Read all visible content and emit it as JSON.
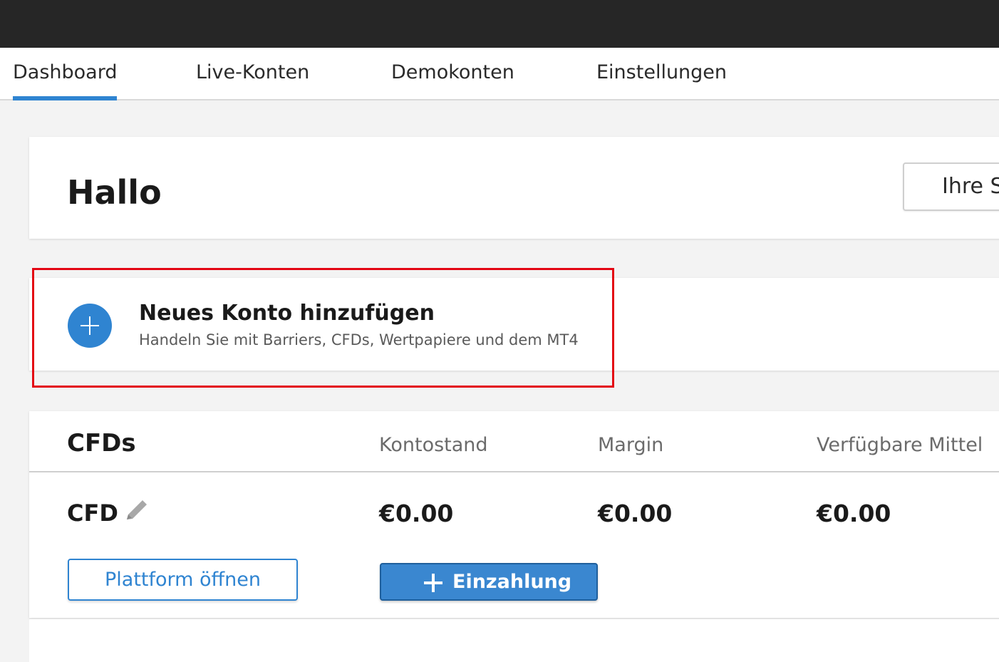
{
  "tabs": [
    {
      "label": "Dashboard",
      "active": true
    },
    {
      "label": "Live-Konten",
      "active": false
    },
    {
      "label": "Demokonten",
      "active": false
    },
    {
      "label": "Einstellungen",
      "active": false
    }
  ],
  "hello": {
    "greeting": "Hallo",
    "button_label": "Ihre S"
  },
  "add_account": {
    "icon": "plus-circle-icon",
    "title": "Neues Konto hinzufügen",
    "subtitle": "Handeln Sie mit Barriers, CFDs, Wertpapiere und dem MT4"
  },
  "cfd_section": {
    "title": "CFDs",
    "columns": [
      "Kontostand",
      "Margin",
      "Verfügbare Mittel"
    ],
    "account": {
      "name": "CFD",
      "edit_icon": "pencil-icon",
      "values": [
        "€0.00",
        "€0.00",
        "€0.00"
      ]
    },
    "open_platform_label": "Plattform öffnen",
    "deposit_label": "Einzahlung"
  },
  "colors": {
    "accent": "#2f84d1",
    "highlight": "#e30613",
    "topbar": "#262626"
  }
}
